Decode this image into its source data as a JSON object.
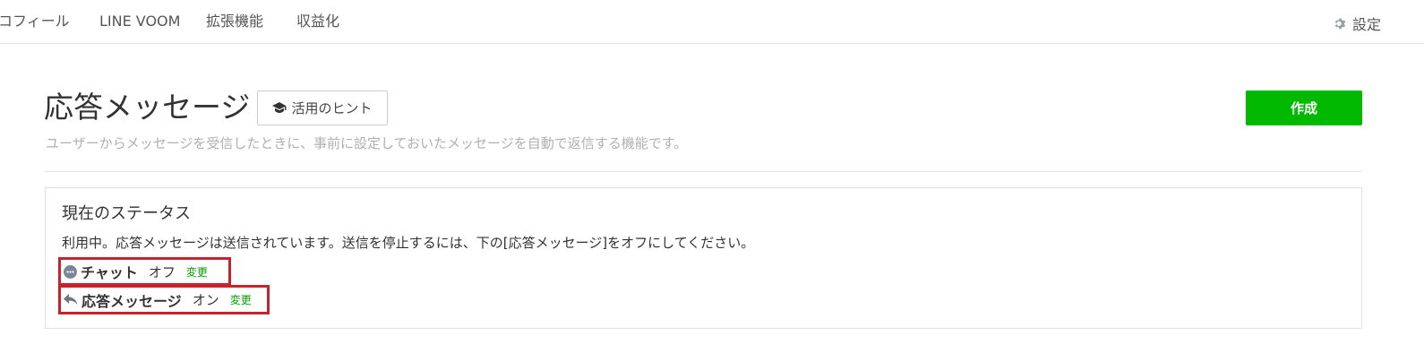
{
  "nav": {
    "items": [
      "コフィール",
      "LINE VOOM",
      "拡張機能",
      "収益化"
    ],
    "settings_label": "設定",
    "settings_icon": "gear-icon"
  },
  "page": {
    "title": "応答メッセージ",
    "hint_button": "活用のヒント",
    "hint_icon": "graduation-cap-icon",
    "create_button": "作成",
    "subtitle": "ユーザーからメッセージを受信したときに、事前に設定しておいたメッセージを自動で返信する機能です。"
  },
  "status": {
    "heading": "現在のステータス",
    "description": "利用中。応答メッセージは送信されています。送信を停止するには、下の[応答メッセージ]をオフにしてください。",
    "rows": [
      {
        "icon": "chat-bubble-icon",
        "name": "チャット",
        "value": "オフ",
        "change_label": "変更"
      },
      {
        "icon": "reply-arrow-icon",
        "name": "応答メッセージ",
        "value": "オン",
        "change_label": "変更"
      }
    ]
  },
  "colors": {
    "accent_green": "#00b900",
    "highlight_red": "#c8232c",
    "change_link": "#00a000",
    "subtitle_gray": "#b0b0b0"
  }
}
